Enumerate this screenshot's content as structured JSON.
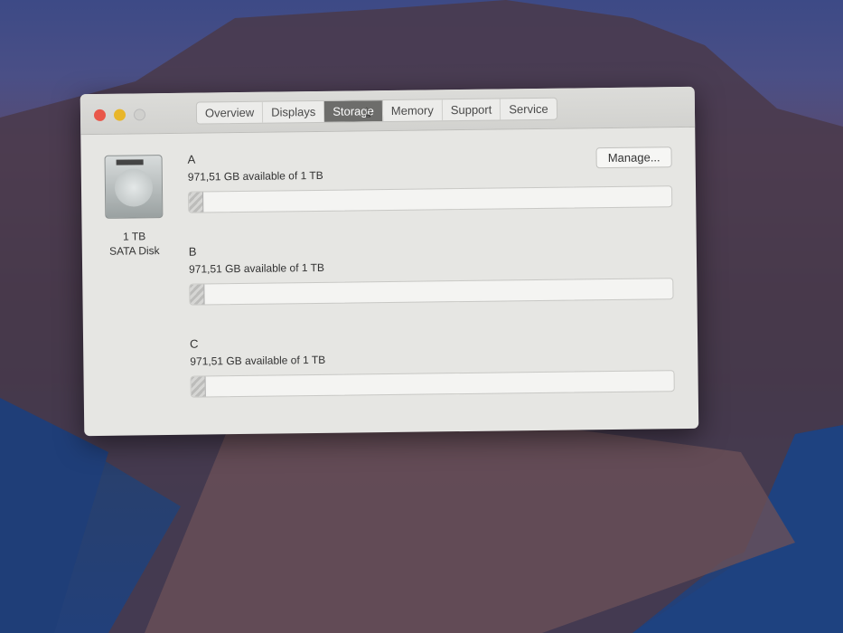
{
  "window": {
    "tabs": [
      "Overview",
      "Displays",
      "Storage",
      "Memory",
      "Support",
      "Service"
    ],
    "active_tab": 2,
    "disk": {
      "capacity": "1 TB",
      "type": "SATA Disk"
    },
    "manage_label": "Manage...",
    "volumes": [
      {
        "name": "A",
        "available": "971,51 GB available of 1 TB",
        "used_fraction": 0.028
      },
      {
        "name": "B",
        "available": "971,51 GB available of 1 TB",
        "used_fraction": 0.028
      },
      {
        "name": "C",
        "available": "971,51 GB available of 1 TB",
        "used_fraction": 0.028
      }
    ]
  },
  "colors": {
    "close": "#e9574a",
    "minimize": "#e8b62a",
    "zoom": "#d0d0cd"
  }
}
